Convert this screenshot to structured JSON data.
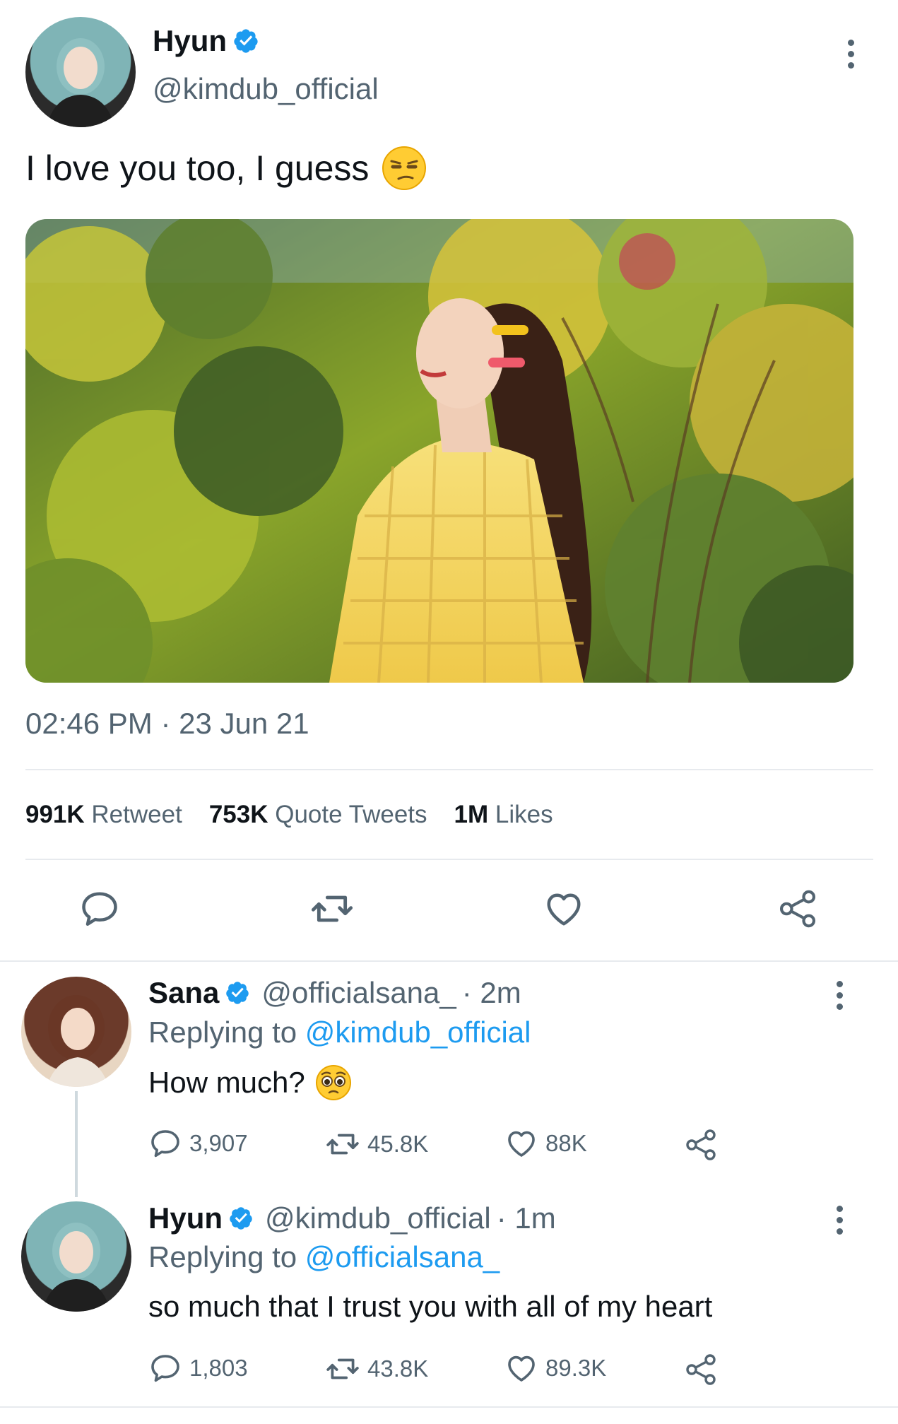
{
  "main_tweet": {
    "author_name": "Hyun",
    "handle": "@kimdub_official",
    "text": "I love you too, I guess",
    "emoji": "unamused-face",
    "timestamp": "02:46 PM · 23 Jun 21",
    "stats": {
      "retweets_count": "991K",
      "retweets_label": "Retweet",
      "quotes_count": "753K",
      "quotes_label": "Quote Tweets",
      "likes_count": "1M",
      "likes_label": "Likes"
    }
  },
  "replies": [
    {
      "author_name": "Sana",
      "handle": "@officialsana_",
      "time": "· 2m",
      "replying_prefix": "Replying to",
      "replying_to": "@kimdub_official",
      "text": "How much?",
      "emoji": "pleading-face",
      "reply_count": "3,907",
      "retweet_count": "45.8K",
      "like_count": "88K"
    },
    {
      "author_name": "Hyun",
      "handle": "@kimdub_official",
      "time": "· 1m",
      "replying_prefix": "Replying to",
      "replying_to": "@officialsana_",
      "text": "so much that I trust you with all of my heart",
      "reply_count": "1,803",
      "retweet_count": "43.8K",
      "like_count": "89.3K"
    }
  ],
  "colors": {
    "accent": "#1d9bf0",
    "muted": "#536471",
    "divider": "#e7eaee"
  }
}
